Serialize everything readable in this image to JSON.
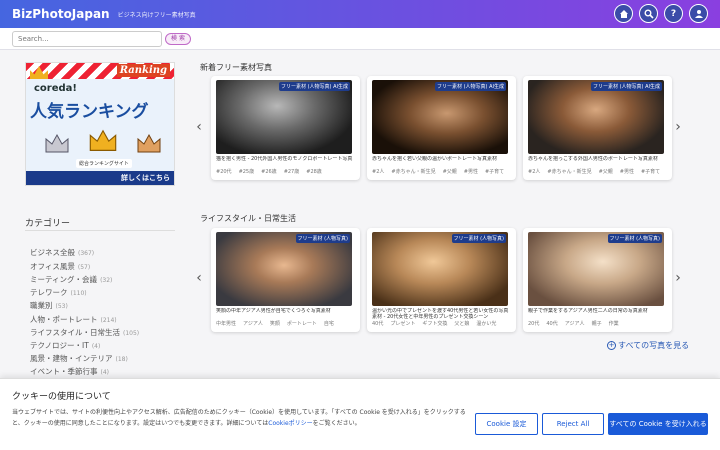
{
  "header": {
    "brand": "BizPhotoJapan",
    "tagline": "ビジネス向けフリー素材写真"
  },
  "search": {
    "placeholder": "Search...",
    "button": "検 索"
  },
  "banner": {
    "coreda": "coreda!",
    "title": "人気ランキング",
    "ranking": "Ranking",
    "site": "総合ランキングサイト",
    "more": "詳しくはこちら"
  },
  "sidebar": {
    "title": "カテゴリー",
    "items": [
      {
        "label": "ビジネス全般",
        "count": "(367)"
      },
      {
        "label": "オフィス風景",
        "count": "(57)"
      },
      {
        "label": "ミーティング・会議",
        "count": "(32)"
      },
      {
        "label": "テレワーク",
        "count": "(110)"
      },
      {
        "label": "職業別",
        "count": "(53)"
      },
      {
        "label": "人物・ポートレート",
        "count": "(214)"
      },
      {
        "label": "ライフスタイル・日常生活",
        "count": "(105)"
      },
      {
        "label": "テクノロジー・IT",
        "count": "(4)"
      },
      {
        "label": "風景・建物・インテリア",
        "count": "(18)"
      },
      {
        "label": "イベント・季節行事",
        "count": "(4)"
      }
    ]
  },
  "sections": [
    {
      "title": "新着フリー素材写真",
      "cards": [
        {
          "badge": "フリー素材 (人物写真) AI生成",
          "text": "猫を抱く男性 - 20代外国人男性のモノクロポートレート写真",
          "tags": [
            "#20代",
            "#25歳",
            "#26歳",
            "#27歳",
            "#28歳"
          ]
        },
        {
          "badge": "フリー素材 (人物写真) AI生成",
          "text": "赤ちゃんを抱く若い父親の温かいポートレート写真素材",
          "tags": [
            "#2人",
            "#赤ちゃん・新生児",
            "#父親",
            "#男性",
            "#子育て"
          ]
        },
        {
          "badge": "フリー素材 (人物写真) AI生成",
          "text": "赤ちゃんを抱っこする外国人男性のポートレート写真素材",
          "tags": [
            "#2人",
            "#赤ちゃん・新生児",
            "#父親",
            "#男性",
            "#子育て"
          ]
        }
      ]
    },
    {
      "title": "ライフスタイル・日常生活",
      "cards": [
        {
          "badge": "フリー素材 (人物写真)",
          "text": "笑顔の中年アジア人男性が自宅でくつろぐ写真素材",
          "tags": [
            "中年男性",
            "アジア人",
            "笑顔",
            "ポートレート",
            "自宅"
          ]
        },
        {
          "badge": "フリー素材 (人物写真)",
          "text": "温かい光の中でプレゼントを渡す40代男性と若い女性の写真素材 - 20代女性と中年男性のプレゼント交換シーン",
          "tags": [
            "40代",
            "プレゼント",
            "ギフト交換",
            "父と娘",
            "温かい光"
          ]
        },
        {
          "badge": "フリー素材 (人物写真)",
          "text": "親子で作業をするアジア人男性二人の日常の写真素材",
          "tags": [
            "20代",
            "40代",
            "アジア人",
            "親子",
            "作業"
          ]
        }
      ]
    }
  ],
  "see_all": "すべての写真を見る",
  "cookie": {
    "title": "クッキーの使用について",
    "text": "当ウェブサイトでは、サイトの利便性向上やアクセス解析、広告配信のためにクッキー（Cookie）を使用しています。「すべての Cookie を受け入れる」をクリックすると、クッキーの使用に同意したことになります。設定はいつでも変更できます。詳細については",
    "link": "Cookieポリシー",
    "text_end": "をご覧ください。",
    "btn_settings": "Cookie 設定",
    "btn_reject": "Reject All",
    "btn_accept": "すべての Cookie を受け入れる"
  }
}
